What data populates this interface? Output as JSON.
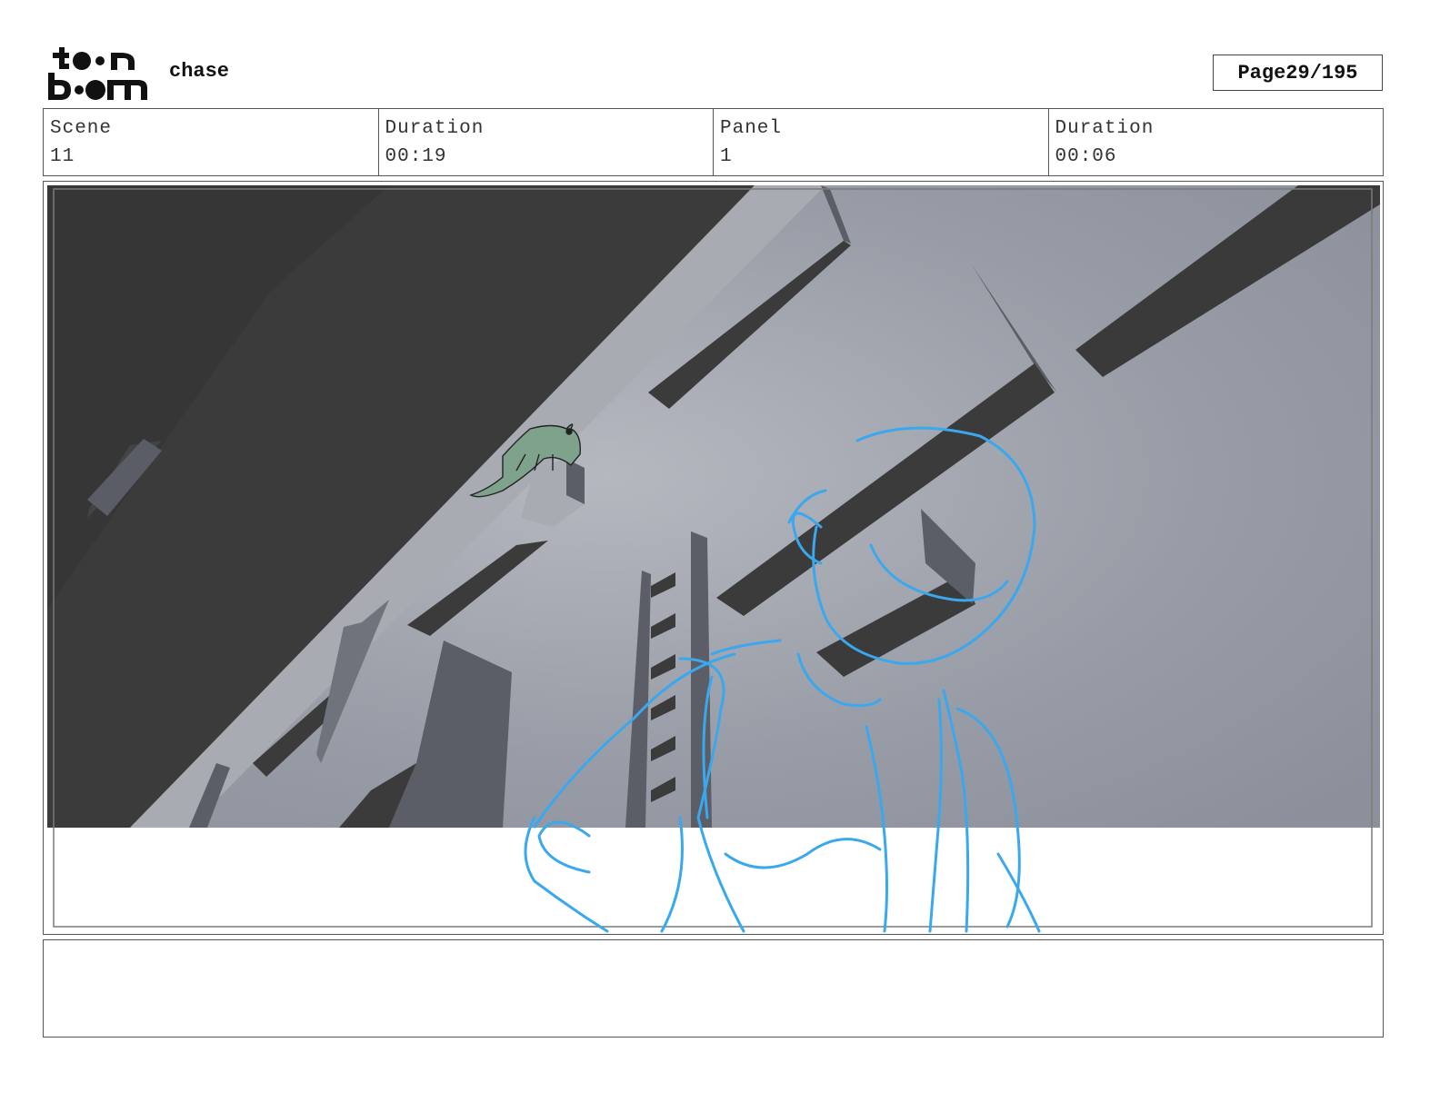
{
  "header": {
    "brand_top": "toon",
    "brand_bottom": "boom",
    "project_title": "chase",
    "page_label": "Page",
    "page_value": "29/195"
  },
  "info": [
    {
      "label": "Scene",
      "value": "11"
    },
    {
      "label": "Duration",
      "value": "00:19"
    },
    {
      "label": "Panel",
      "value": "1"
    },
    {
      "label": "Duration",
      "value": "00:06"
    }
  ],
  "notes": {
    "text": ""
  },
  "colors": {
    "sky": "#9499a3",
    "building_dark": "#3a3a3a",
    "building_face": "#a5a8b0",
    "sketch_blue": "#3aa8ee",
    "creature_green": "#6f9a7e"
  }
}
